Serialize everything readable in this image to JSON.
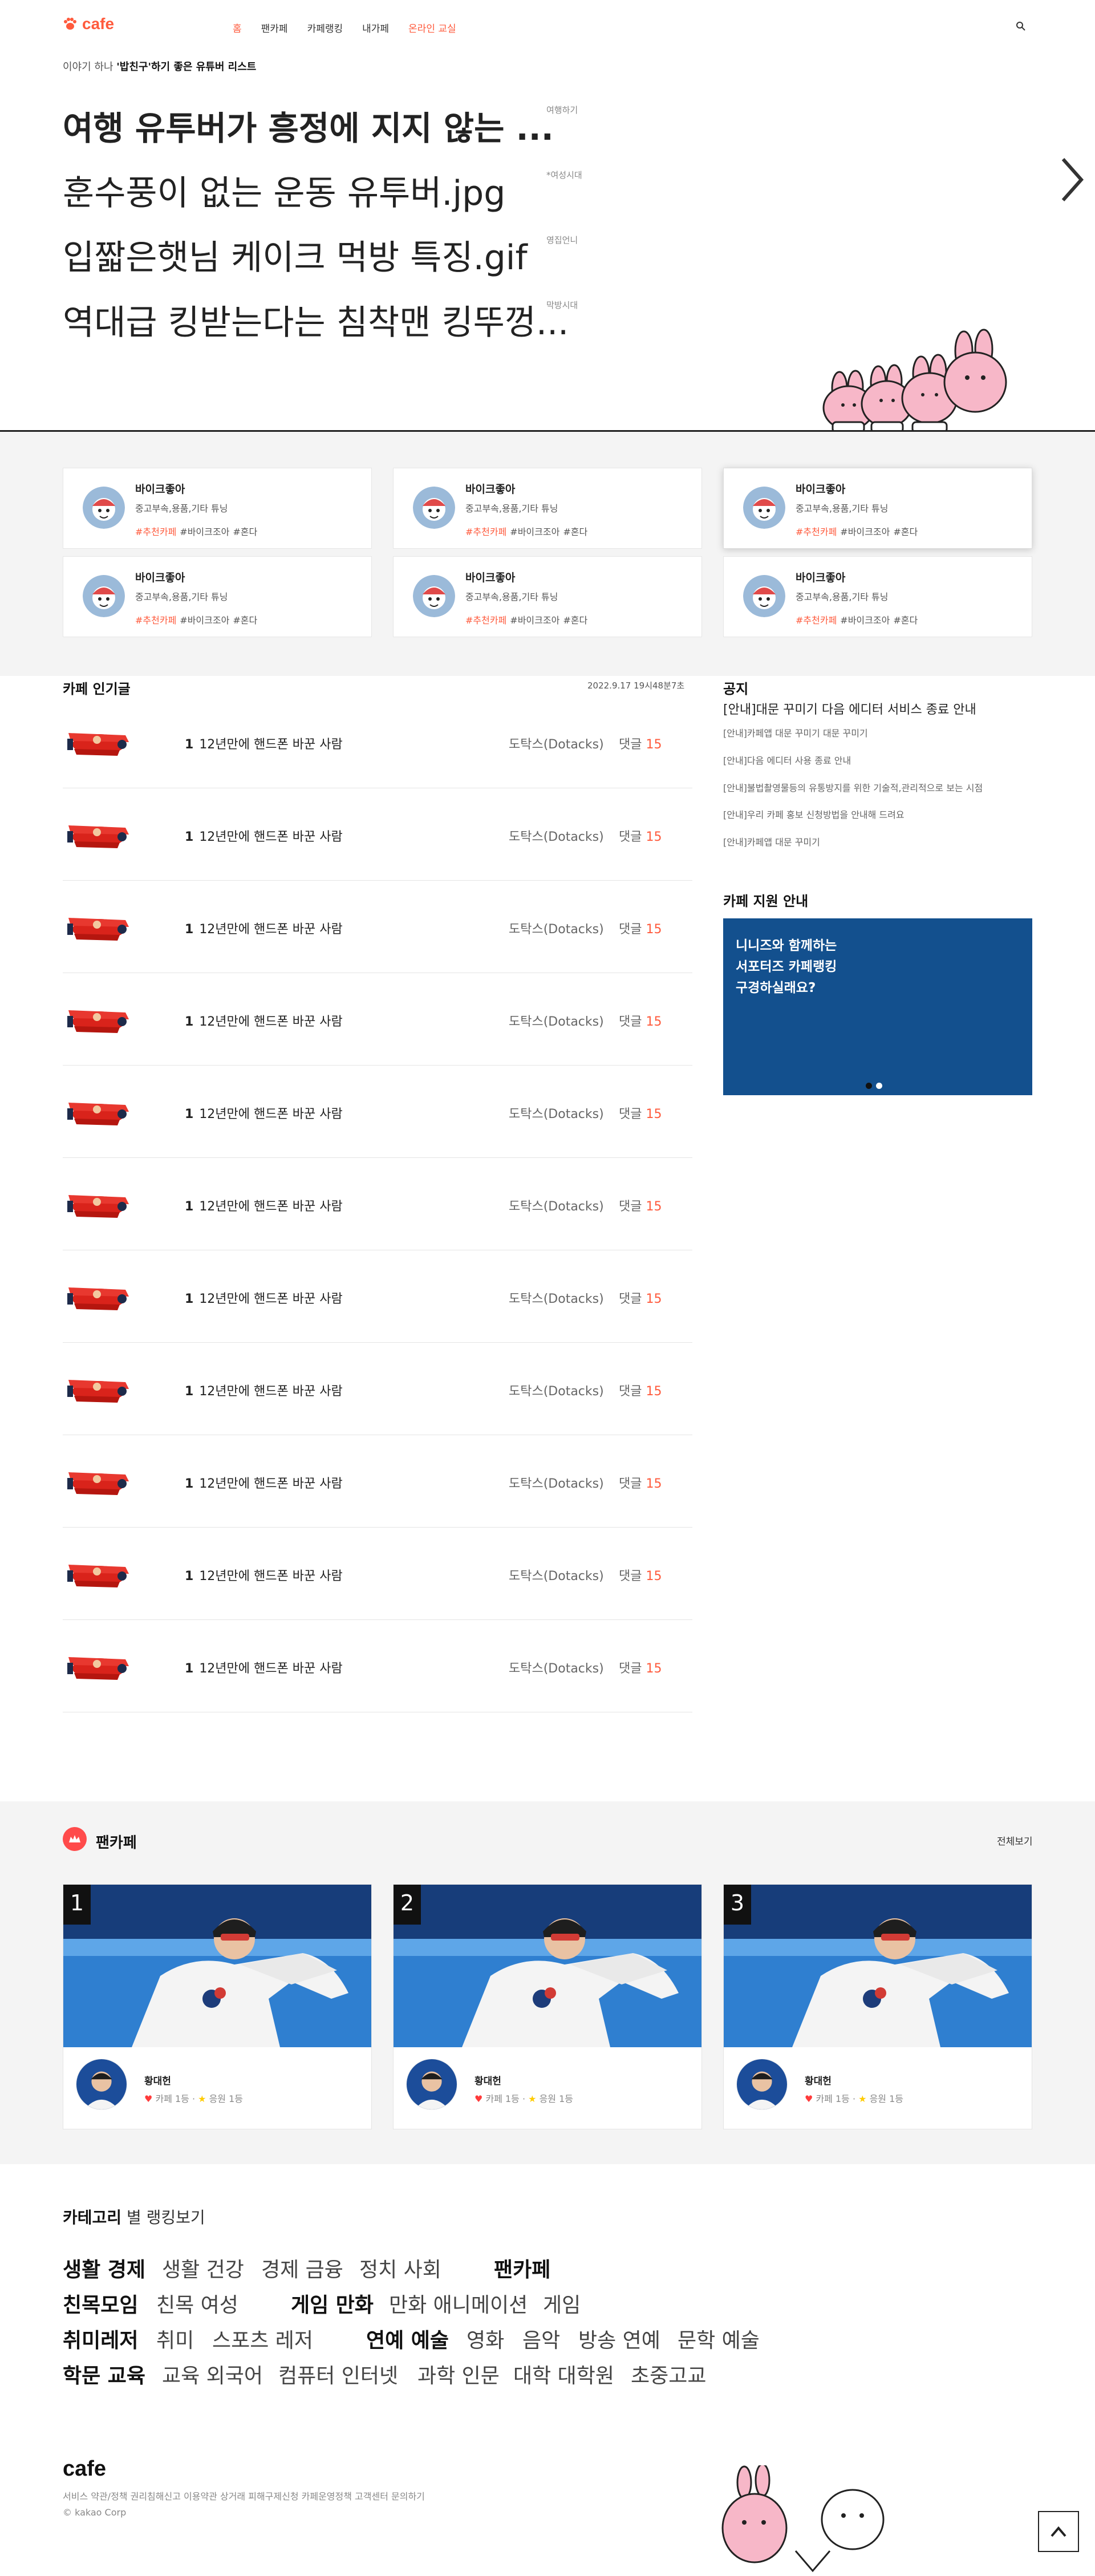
{
  "header": {
    "logo_text": "cafe",
    "nav": [
      "홈",
      "팬카페",
      "카페랭킹",
      "내가페",
      "온라인 교실"
    ],
    "subtitle_pre": "이야기 하나 ",
    "subtitle_bold": "'밥친구'하기 좋은 유튜버 리스트"
  },
  "hero": {
    "items": [
      {
        "title": "여행 유투버가 흥정에 지지 않는 ...",
        "tag": "여행하기"
      },
      {
        "title": "훈수풍이 없는 운동 유투버.jpg",
        "tag": "*여성시대"
      },
      {
        "title": "입짧은햇님 케이크 먹방 특징.gif",
        "tag": "영집언니"
      },
      {
        "title": "역대급 킹받는다는 침착맨 킹뚜껑...",
        "tag": "막방시대"
      }
    ]
  },
  "cafe_cards": [
    {
      "name": "바이크좋아",
      "category": "중고부속,용품,기타 튜닝",
      "tag1": "#추천카페",
      "tag2": "#바이크조아",
      "tag3": "#혼다"
    },
    {
      "name": "바이크좋아",
      "category": "중고부속,용품,기타 튜닝",
      "tag1": "#추천카페",
      "tag2": "#바이크조아",
      "tag3": "#혼다"
    },
    {
      "name": "바이크좋아",
      "category": "중고부속,용품,기타 튜닝",
      "tag1": "#추천카페",
      "tag2": "#바이크조아",
      "tag3": "#혼다"
    },
    {
      "name": "바이크좋아",
      "category": "중고부속,용품,기타 튜닝",
      "tag1": "#추천카페",
      "tag2": "#바이크조아",
      "tag3": "#혼다"
    },
    {
      "name": "바이크좋아",
      "category": "중고부속,용품,기타 튜닝",
      "tag1": "#추천카페",
      "tag2": "#바이크조아",
      "tag3": "#혼다"
    },
    {
      "name": "바이크좋아",
      "category": "중고부속,용품,기타 튜닝",
      "tag1": "#추천카페",
      "tag2": "#바이크조아",
      "tag3": "#혼다"
    }
  ],
  "popular": {
    "title": "카페 인기글",
    "date": "2022.9.17 19시48분7초",
    "rows": [
      {
        "rank": "1",
        "title": "12년만에 핸드폰 바꾼 사람",
        "author": "도탁스(Dotacks)",
        "comment_label": "댓글",
        "comments": "15"
      },
      {
        "rank": "1",
        "title": "12년만에 핸드폰 바꾼 사람",
        "author": "도탁스(Dotacks)",
        "comment_label": "댓글",
        "comments": "15"
      },
      {
        "rank": "1",
        "title": "12년만에 핸드폰 바꾼 사람",
        "author": "도탁스(Dotacks)",
        "comment_label": "댓글",
        "comments": "15"
      },
      {
        "rank": "1",
        "title": "12년만에 핸드폰 바꾼 사람",
        "author": "도탁스(Dotacks)",
        "comment_label": "댓글",
        "comments": "15"
      },
      {
        "rank": "1",
        "title": "12년만에 핸드폰 바꾼 사람",
        "author": "도탁스(Dotacks)",
        "comment_label": "댓글",
        "comments": "15"
      },
      {
        "rank": "1",
        "title": "12년만에 핸드폰 바꾼 사람",
        "author": "도탁스(Dotacks)",
        "comment_label": "댓글",
        "comments": "15"
      },
      {
        "rank": "1",
        "title": "12년만에 핸드폰 바꾼 사람",
        "author": "도탁스(Dotacks)",
        "comment_label": "댓글",
        "comments": "15"
      },
      {
        "rank": "1",
        "title": "12년만에 핸드폰 바꾼 사람",
        "author": "도탁스(Dotacks)",
        "comment_label": "댓글",
        "comments": "15"
      },
      {
        "rank": "1",
        "title": "12년만에 핸드폰 바꾼 사람",
        "author": "도탁스(Dotacks)",
        "comment_label": "댓글",
        "comments": "15"
      },
      {
        "rank": "1",
        "title": "12년만에 핸드폰 바꾼 사람",
        "author": "도탁스(Dotacks)",
        "comment_label": "댓글",
        "comments": "15"
      },
      {
        "rank": "1",
        "title": "12년만에 핸드폰 바꾼 사람",
        "author": "도탁스(Dotacks)",
        "comment_label": "댓글",
        "comments": "15"
      }
    ]
  },
  "notice": {
    "title": "공지",
    "headline": "[안내]대문 꾸미기 다음 에디터 서비스 종료 안내",
    "items": [
      "[안내]카페앱 대문 꾸미기 대문 꾸미기",
      "[안내]다음 에디터 사용 종료 안내",
      "[안내]불법촬영물등의 유통방지를 위한 기술적,관리적으로 보는 시점",
      "[안내]우리 카페 홍보 신청방법을 안내해 드려요",
      "[안내]카페앱 대문 꾸미기"
    ]
  },
  "support": {
    "title": "카페 지원 안내",
    "line1": "니니즈와 함께하는",
    "line2": "서포터즈 카페랭킹",
    "line3": "구경하실래요?"
  },
  "fan_cafe": {
    "title": "팬카페",
    "view_all": "전체보기",
    "cards": [
      {
        "rank": "1",
        "name": "황대헌",
        "cafe_rank": "카페 1등",
        "member_rank": "응원 1등"
      },
      {
        "rank": "2",
        "name": "황대헌",
        "cafe_rank": "카페 1등",
        "member_rank": "응원 1등"
      },
      {
        "rank": "3",
        "name": "황대헌",
        "cafe_rank": "카페 1등",
        "member_rank": "응원 1등"
      }
    ]
  },
  "categories": {
    "head_bold": "카테고리",
    "head_rest": " 별 랭킹보기",
    "rows": [
      {
        "main": "생활 경제",
        "subs": [
          "생활 건강",
          "경제 금융",
          "정치 사회"
        ],
        "main2": "팬카페",
        "subs2": []
      },
      {
        "main": "친목모임",
        "subs": [
          "친목 여성"
        ],
        "main2": "게임 만화",
        "subs2": [
          "만화 애니메이션",
          "게임"
        ]
      },
      {
        "main": "취미레저",
        "subs": [
          "취미",
          "스포츠 레저"
        ],
        "main2": "연예 예술",
        "subs2": [
          "영화",
          "음악",
          "방송 연예",
          "문학 예술"
        ]
      },
      {
        "main": "학문 교육",
        "subs": [
          "교육 외국어",
          "컴퓨터 인터넷",
          "과학 인문",
          "대학 대학원",
          "초중고교"
        ],
        "main2": "",
        "subs2": []
      }
    ]
  },
  "footer": {
    "logo": "cafe",
    "links": "서비스 약관/정책 권리침해신고 이용약관 상거래 피해구제신청 카페운영정책 고객센터 문의하기",
    "copyright": "© kakao Corp"
  },
  "colors": {
    "accent": "#ff5a3c",
    "support_bg": "#13508e",
    "band_bg": "#f4f4f4"
  }
}
